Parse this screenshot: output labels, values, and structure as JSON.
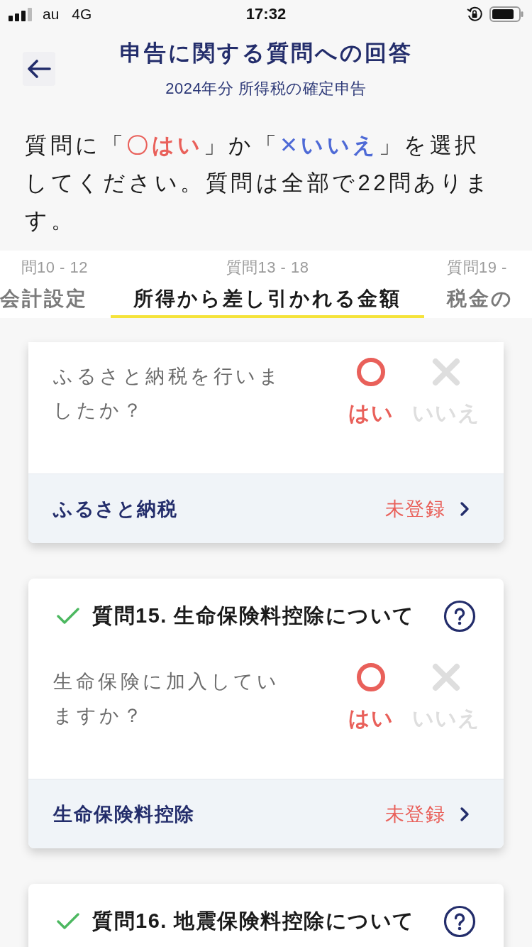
{
  "status_bar": {
    "carrier": "au",
    "network": "4G",
    "time": "17:32"
  },
  "header": {
    "title": "申告に関する質問への回答",
    "subtitle": "2024年分 所得税の確定申告"
  },
  "instruction": [
    {
      "kind": "plain",
      "text": "質問に「"
    },
    {
      "kind": "yes",
      "text": "〇はい"
    },
    {
      "kind": "plain",
      "text": "」か「"
    },
    {
      "kind": "no",
      "text": "✕いいえ"
    },
    {
      "kind": "plain",
      "text": "」を選択してください。質問は全部で22問あります。"
    }
  ],
  "tabs": [
    {
      "range": "問10 - 12",
      "label": "会計設定",
      "selected": false
    },
    {
      "range": "質問13 - 18",
      "label": "所得から差し引かれる金額",
      "selected": true
    },
    {
      "range": "質問19 -",
      "label": "税金の",
      "selected": false
    }
  ],
  "cards": [
    {
      "question": "ふるさと納税を行いましたか？",
      "options": [
        {
          "kind": "yes",
          "label": "はい",
          "selected": true
        },
        {
          "kind": "no",
          "label": "いいえ",
          "selected": false
        }
      ],
      "link": {
        "label": "ふるさと納税",
        "status": "未登録"
      }
    },
    {
      "done": true,
      "title": "質問15. 生命保険料控除について",
      "question": "生命保険に加入していますか？",
      "options": [
        {
          "kind": "yes",
          "label": "はい",
          "selected": true
        },
        {
          "kind": "no",
          "label": "いいえ",
          "selected": false
        }
      ],
      "link": {
        "label": "生命保険料控除",
        "status": "未登録"
      }
    },
    {
      "done": true,
      "title": "質問16. 地震保険料控除について"
    }
  ]
}
